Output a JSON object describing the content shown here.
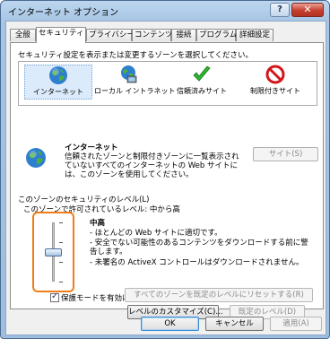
{
  "window": {
    "title": "インターネット オプション",
    "help_label": "?",
    "close_label": "✕"
  },
  "tabs": [
    {
      "label": "全般"
    },
    {
      "label": "セキュリティ"
    },
    {
      "label": "プライバシー"
    },
    {
      "label": "コンテンツ"
    },
    {
      "label": "接続"
    },
    {
      "label": "プログラム"
    },
    {
      "label": "詳細設定"
    }
  ],
  "zones": {
    "instruction": "セキュリティ設定を表示または変更するゾーンを選択してください。",
    "items": [
      {
        "label": "インターネット",
        "icon": "globe-icon"
      },
      {
        "label": "ローカル イントラネット",
        "icon": "intranet-icon"
      },
      {
        "label": "信頼済みサイト",
        "icon": "checkmark-icon"
      },
      {
        "label": "制限付きサイト",
        "icon": "no-entry-icon"
      }
    ]
  },
  "zone_info": {
    "title": "インターネット",
    "description": "信頼されたゾーンと制限付きゾーンに一覧表示されていないすべてのインターネットの Web サイトには、このゾーンを使用してください。",
    "sites_button": "サイト(S)"
  },
  "security_level": {
    "group_title": "このゾーンのセキュリティのレベル(L)",
    "allowed_text": "このゾーンで許可されているレベル: 中から高",
    "level_name": "中高",
    "level_position": 0.5,
    "bullets": [
      "- ほとんどの Web サイトに適切です。",
      "- 安全でない可能性のあるコンテンツをダウンロードする前に警告します。",
      "- 未署名の ActiveX コントロールはダウンロードされません。"
    ],
    "protected_mode_label": "保護モードを有効にする (Internet Explorer の再起動が必要)(P)",
    "protected_mode_checked": true,
    "custom_level_button": "レベルのカスタマイズ(C)...",
    "default_level_button": "既定のレベル(D)",
    "reset_all_button": "すべてのゾーンを既定のレベルにリセットする(R)"
  },
  "footer": {
    "ok": "OK",
    "cancel": "キャンセル",
    "apply": "適用(A)"
  },
  "colors": {
    "slider_highlight": "#f07d18",
    "restricted_icon": "#d3161b",
    "trusted_icon": "#2db42d"
  }
}
